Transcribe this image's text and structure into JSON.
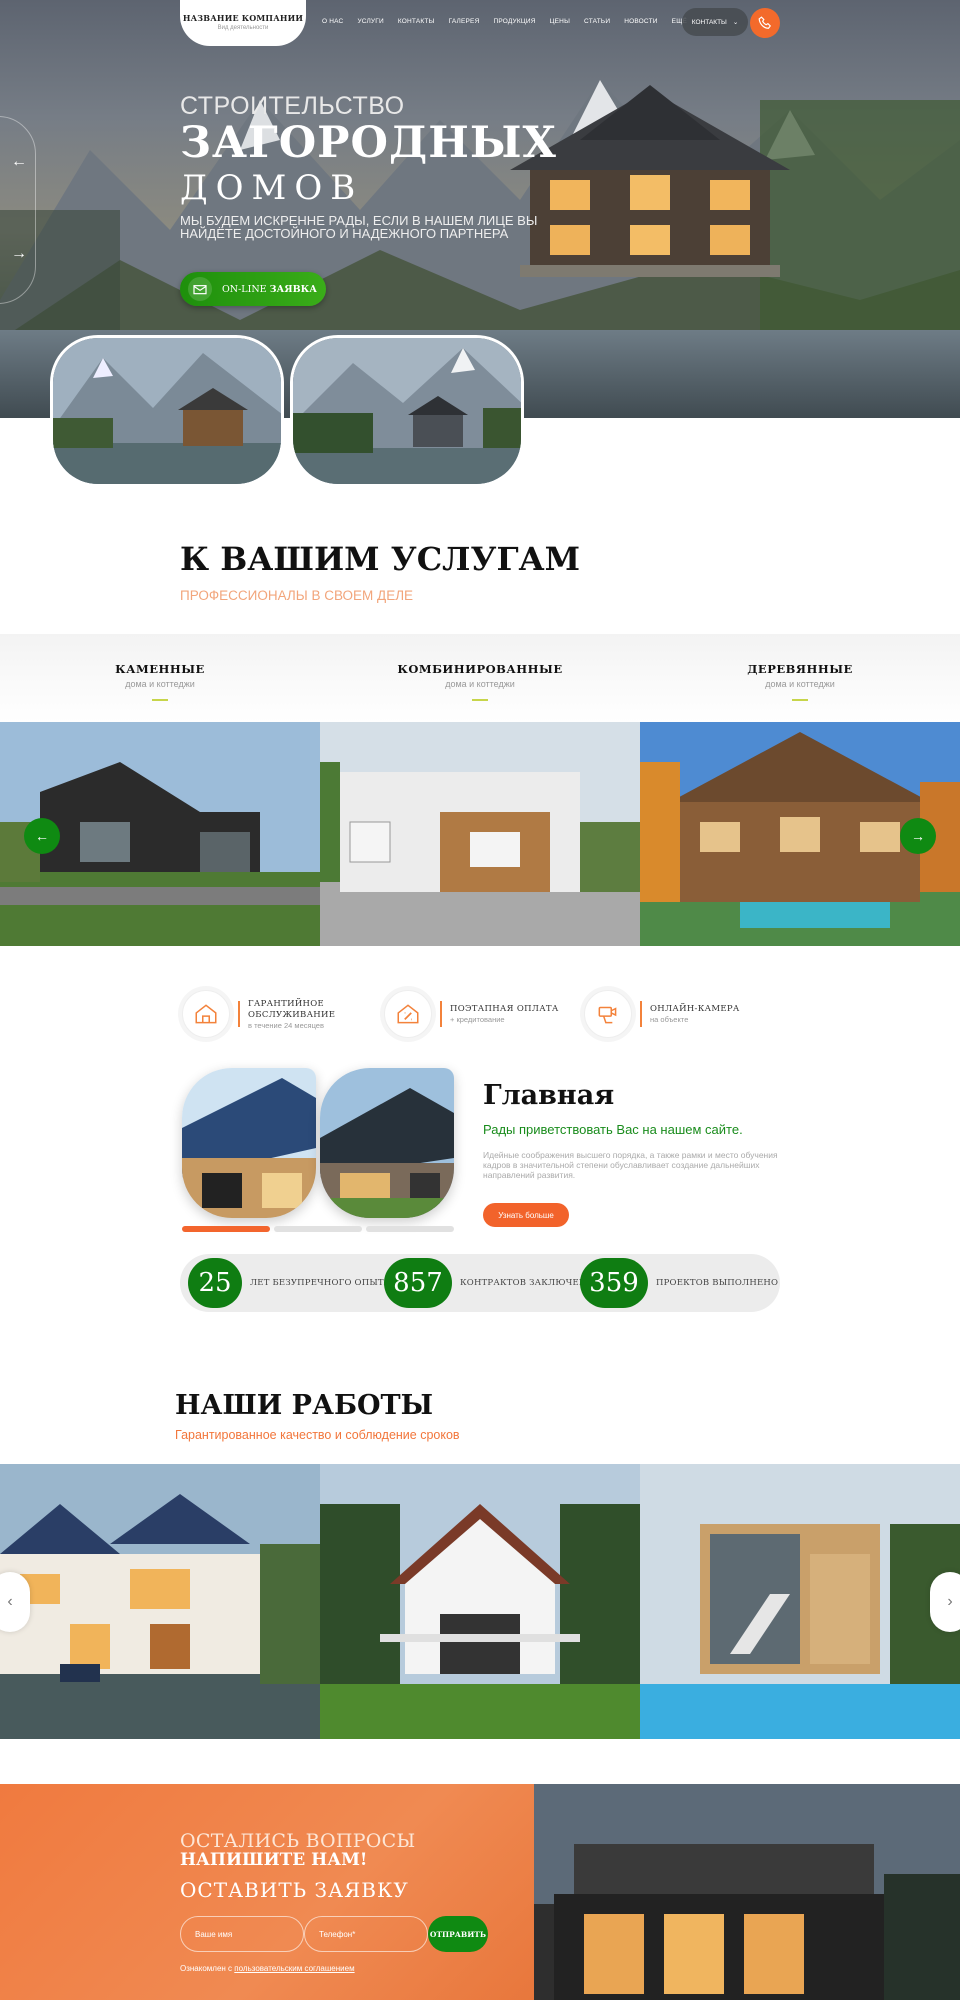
{
  "header": {
    "company_name": "НАЗВАНИЕ КОМПАНИИ",
    "company_sub": "Вид деятельности",
    "nav": [
      "О НАС",
      "УСЛУГИ",
      "КОНТАКТЫ",
      "ГАЛЕРЕЯ",
      "ПРОДУКЦИЯ",
      "ЦЕНЫ",
      "СТАТЬИ",
      "НОВОСТИ",
      "ЕЩЁ"
    ],
    "contacts_label": "КОНТАКТЫ"
  },
  "hero": {
    "line1": "СТРОИТЕЛЬСТВО",
    "line2": "ЗАГОРОДНЫХ",
    "line3": "ДОМОВ",
    "desc": "МЫ БУДЕМ ИСКРЕННЕ РАДЫ, ЕСЛИ В НАШЕМ ЛИЦЕ ВЫ НАЙДЁТЕ ДОСТОЙНОГО И НАДЕЖНОГО ПАРТНЕРА",
    "button_prefix": "ON-LINE",
    "button_main": "ЗАЯВКА"
  },
  "services": {
    "title": "К ВАШИМ УСЛУГАМ",
    "subtitle": "ПРОФЕССИОНАЛЫ В СВОЕМ ДЕЛЕ",
    "tabs": [
      {
        "title": "КАМЕННЫЕ",
        "desc": "дома и коттеджи"
      },
      {
        "title": "КОМБИНИРОВАННЫЕ",
        "desc": "дома и коттеджи"
      },
      {
        "title": "ДЕРЕВЯННЫЕ",
        "desc": "дома и коттеджи"
      }
    ]
  },
  "features": [
    {
      "title": "ГАРАНТИЙНОЕ ОБСЛУЖИВАНИЕ",
      "desc": "в течение 24 месяцев",
      "icon": "house-icon"
    },
    {
      "title": "ПОЭТАПНАЯ ОПЛАТА",
      "desc": "+ кредитование",
      "icon": "percent-house-icon"
    },
    {
      "title": "ОНЛАЙН-КАМЕРА",
      "desc": "на объекте",
      "icon": "camera-hand-icon"
    }
  ],
  "about": {
    "title": "Главная",
    "subtitle": "Рады приветствовать Вас на нашем сайте.",
    "desc": "Идейные соображения высшего порядка, а также рамки и место обучения кадров в значительной степени обуславливает создание дальнейших направлений развития.",
    "button": "Узнать больше",
    "progress_active": 1,
    "progress_total": 3
  },
  "stats": [
    {
      "value": "25",
      "label": "ЛЕТ БЕЗУПРЕЧНОГО ОПЫТА"
    },
    {
      "value": "857",
      "label": "КОНТРАКТОВ ЗАКЛЮЧЕНО"
    },
    {
      "value": "359",
      "label": "ПРОЕКТОВ ВЫПОЛНЕНО"
    }
  ],
  "works": {
    "title": "НАШИ РАБОТЫ",
    "subtitle": "Гарантированное качество и соблюдение сроков"
  },
  "cta": {
    "q1": "ОСТАЛИСЬ ВОПРОСЫ",
    "q2": "НАПИШИТЕ НАМ!",
    "q3": "ОСТАВИТЬ ЗАЯВКУ",
    "name_placeholder": "Ваше имя",
    "phone_placeholder": "Телефон*",
    "send": "ОТПРАВИТЬ",
    "agree_prefix": "Ознакомлен с",
    "agree_link": "пользовательским соглашением"
  },
  "colors": {
    "accent_orange": "#f36a2b",
    "accent_green": "#0f8a12",
    "subtitle_orange": "#f2a57b"
  }
}
